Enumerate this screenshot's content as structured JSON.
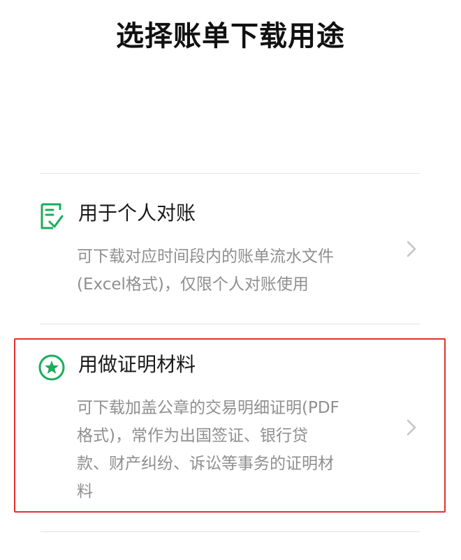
{
  "header": {
    "title": "选择账单下载用途"
  },
  "options": [
    {
      "icon": "document-check-icon",
      "title": "用于个人对账",
      "desc_lines": [
        "可下载对应时间段内的账单流水文件",
        "(Excel格式)，仅限个人对账使用"
      ]
    },
    {
      "icon": "star-circle-icon",
      "title": "用做证明材料",
      "desc_lines": [
        "可下载加盖公章的交易明细证明(PDF",
        "格式)，常作为出国签证、银行贷",
        "款、财产纠纷、诉讼等事务的证明材",
        "料"
      ]
    }
  ],
  "colors": {
    "accent_green": "#1aad5a",
    "highlight_red": "#e0302c",
    "title_text": "#111111",
    "desc_text": "#8f8f8f",
    "divider": "#e2e2e2"
  }
}
